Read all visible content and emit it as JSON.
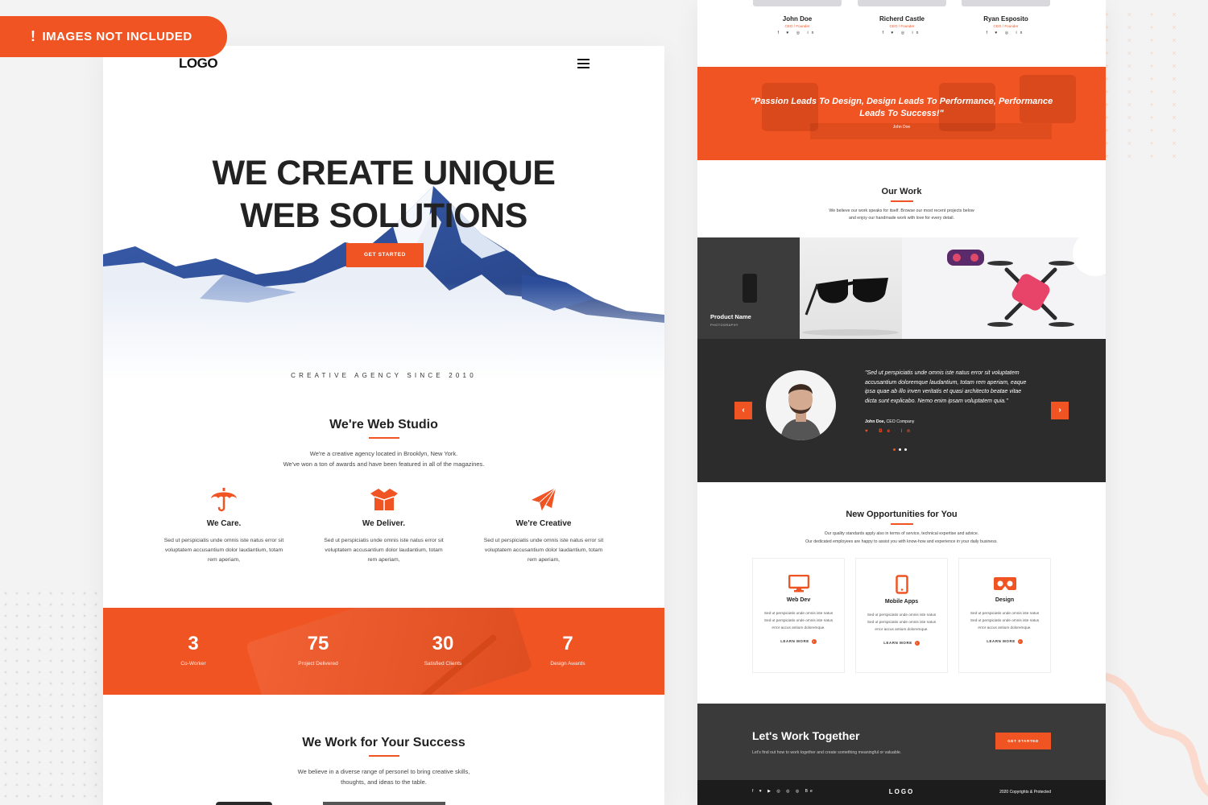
{
  "badge": {
    "icon": "exclamation-icon",
    "text": "IMAGES NOT INCLUDED"
  },
  "colors": {
    "accent": "#f05423",
    "dark": "#2c2c2c",
    "text": "#222222"
  },
  "left": {
    "logo": "LOGO",
    "menu_icon": "hamburger-icon",
    "hero": {
      "title_line1": "WE CREATE UNIQUE",
      "title_line2": "WEB SOLUTIONS",
      "button": "GET STARTED",
      "tagline": "CREATIVE AGENCY SINCE 2010"
    },
    "studio": {
      "title": "We're Web Studio",
      "line1": "We're a creative agency located in Brooklyn, New York.",
      "line2": "We've won a ton of awards and have been featured in all of the magazines."
    },
    "features": [
      {
        "icon": "umbrella-icon",
        "title": "We Care.",
        "text": "Sed ut perspiciatis unde omnis iste natus error sit voluptatem accusantium dolor laudantium, totam rem aperiam,"
      },
      {
        "icon": "box-icon",
        "title": "We Deliver.",
        "text": "Sed ut perspiciatis unde omnis iste natus error sit voluptatem accusantium dolor laudantium, totam rem aperiam,"
      },
      {
        "icon": "paper-plane-icon",
        "title": "We're Creative",
        "text": "Sed ut perspiciatis unde omnis iste natus error sit voluptatem accusantium dolor laudantium, totam rem aperiam,"
      }
    ],
    "stats": [
      {
        "value": "3",
        "label": "Co-Worker"
      },
      {
        "value": "75",
        "label": "Project Delivered"
      },
      {
        "value": "30",
        "label": "Satisfied Clients"
      },
      {
        "value": "7",
        "label": "Design Awards"
      }
    ],
    "success": {
      "title": "We Work for Your Success",
      "line1": "We believe in a diverse range of personel to bring creative skills,",
      "line2": "thoughts, and ideas to the table."
    }
  },
  "right": {
    "team": [
      {
        "name": "John Doe",
        "role": "CEO / Founder",
        "social": "f ♥ ◎ in"
      },
      {
        "name": "Richerd Castle",
        "role": "CEO / Founder",
        "social": "f ♥ ◎ in"
      },
      {
        "name": "Ryan Esposito",
        "role": "CEO / Founder",
        "social": "f ♥ ◎ in"
      }
    ],
    "quote": {
      "text": "\"Passion Leads To Design, Design Leads To Performance, Performance Leads To Success!\"",
      "author": "John Doe"
    },
    "our_work": {
      "title": "Our Work",
      "line1": "We believe our work speaks for itself. Browse our most recent projects below",
      "line2": "and enjoy our handmade work with love for every detail."
    },
    "gallery": {
      "product_name": "Product Name",
      "category": "PHOTOGRAPHY"
    },
    "testimonial": {
      "prev_icon": "chevron-left-icon",
      "next_icon": "chevron-right-icon",
      "prev": "‹",
      "next": "›",
      "quote": "\"Sed ut perspiciatis unde omnis iste natus error sit voluptatem accusantium doloremque laudantium, totam rem aperiam, eaque ipsa quae ab illo inven veritatis et quasi architecto beatae vitae dicta sunt explicabo. Nemo enim ipsam voluptatem quia.\"",
      "author_name": "John Doe,",
      "author_company": " CEO Company",
      "social": "♥ Be in"
    },
    "opportunities": {
      "title": "New Opportunities for You",
      "line1": "Our quality standards apply also in terms of service, technical expertise and advice.",
      "line2": "Our dedicated employees are happy to assist you with know-how and experience in your daily business."
    },
    "services": [
      {
        "icon": "monitor-icon",
        "title": "Web Dev",
        "text": "Sed ut perspiciatis unde omnis iste natus Sed ut perspiciatis unde omnis iste natus error accus antium doloremque.",
        "link": "LEARN MORE"
      },
      {
        "icon": "smartphone-icon",
        "title": "Mobile Apps",
        "text": "Sed ut perspiciatis unde omnis iste natus Sed ut perspiciatis unde omnis iste natus error accus antium doloremque.",
        "link": "LEARN MORE"
      },
      {
        "icon": "vr-headset-icon",
        "title": "Design",
        "text": "Sed ut perspiciatis unde omnis iste natus Sed ut perspiciatis unde omnis iste natus error accus antium doloremque.",
        "link": "LEARN MORE"
      }
    ],
    "cta": {
      "title": "Let's Work Together",
      "text": "Let's find out how to work together and create something meaningful or valuable.",
      "button": "GET STARTED"
    },
    "footer": {
      "social": "f ♥ ▶ ◎ ◎ ◎ Be",
      "logo": "LOGO",
      "copyright": "2020 Copyrights & Protected"
    }
  }
}
